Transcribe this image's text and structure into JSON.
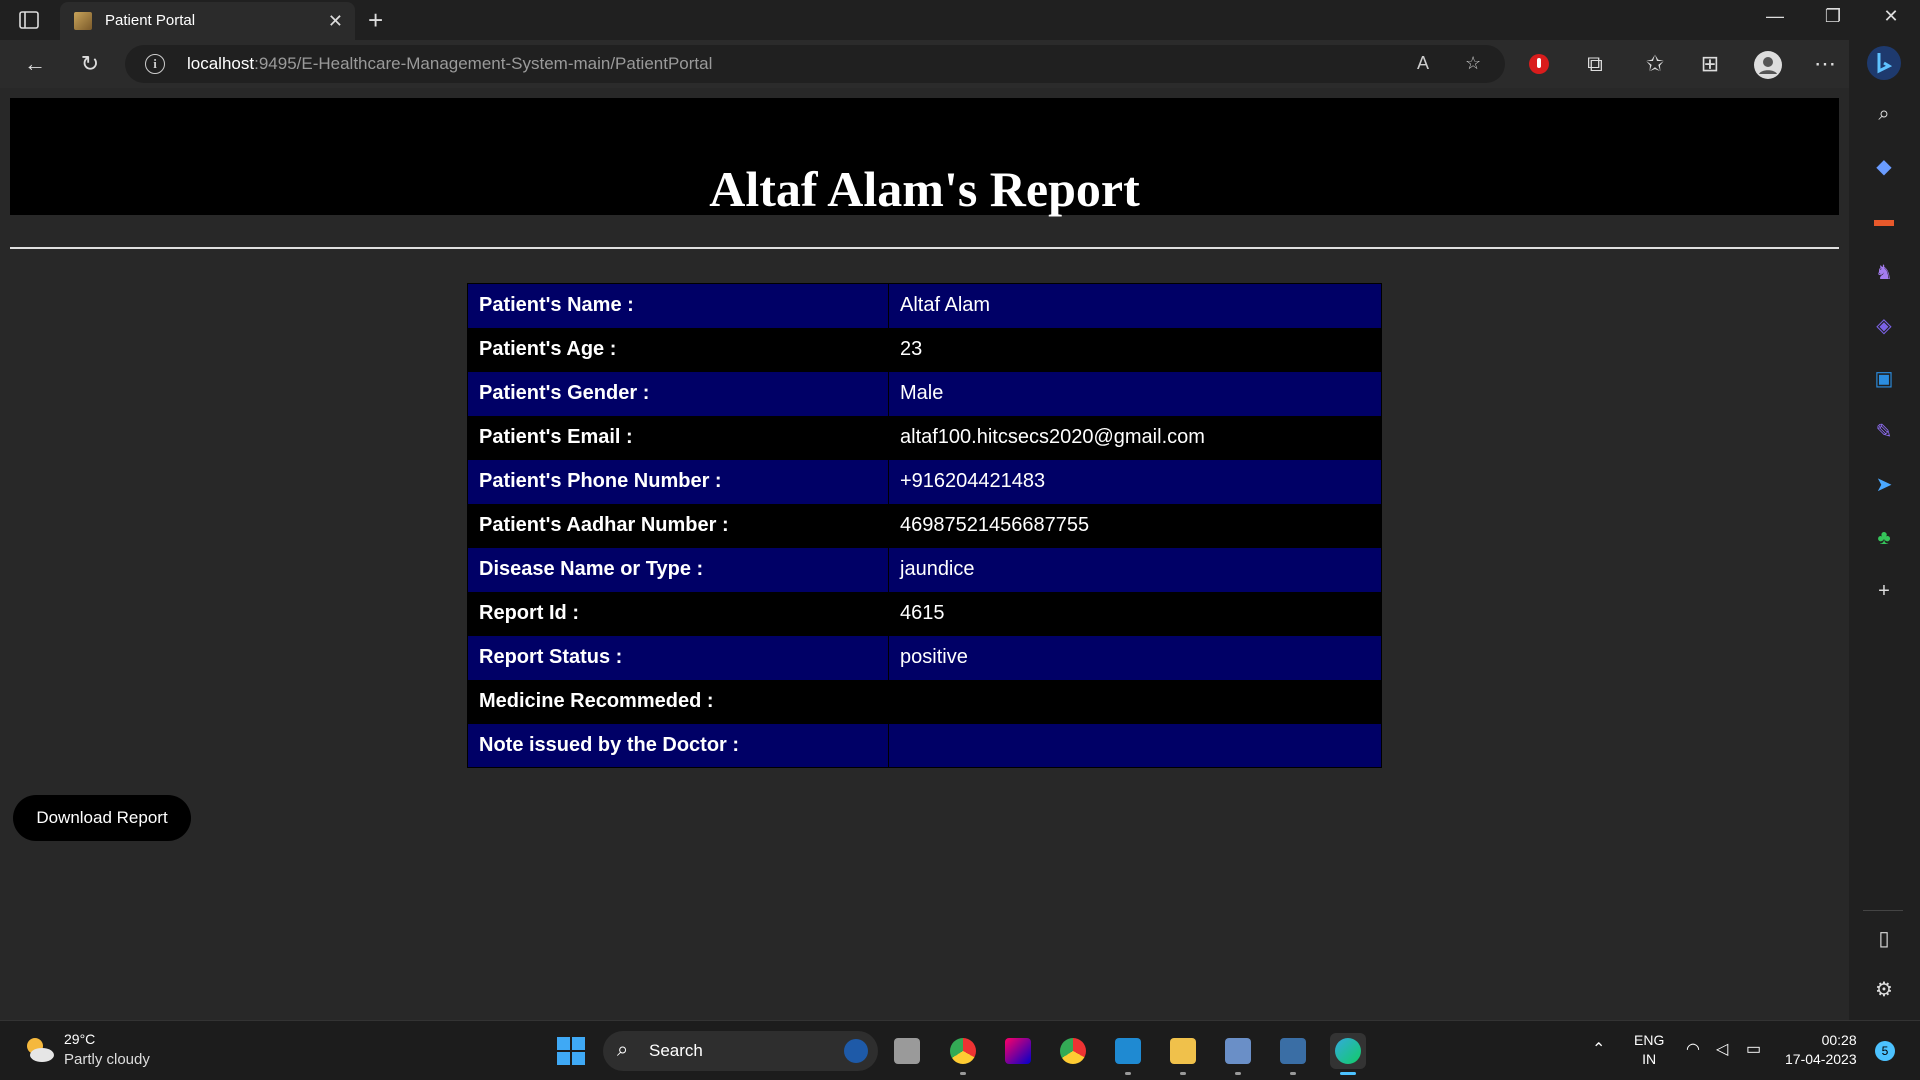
{
  "browser": {
    "tab_title": "Patient Portal",
    "url_host": "localhost",
    "url_path": ":9495/E-Healthcare-Management-System-main/PatientPortal"
  },
  "page": {
    "title": "Altaf Alam's Report",
    "rows": [
      {
        "label": "Patient's Name :",
        "value": "Altaf Alam"
      },
      {
        "label": "Patient's Age :",
        "value": "23"
      },
      {
        "label": "Patient's Gender :",
        "value": "Male"
      },
      {
        "label": "Patient's Email :",
        "value": "altaf100.hitcsecs2020@gmail.com"
      },
      {
        "label": "Patient's Phone Number :",
        "value": "+916204421483"
      },
      {
        "label": "Patient's Aadhar Number :",
        "value": "46987521456687755"
      },
      {
        "label": "Disease Name or Type :",
        "value": "jaundice"
      },
      {
        "label": "Report Id :",
        "value": "4615"
      },
      {
        "label": "Report Status :",
        "value": "positive"
      },
      {
        "label": "Medicine Recommeded :",
        "value": ""
      },
      {
        "label": "Note issued by the Doctor :",
        "value": ""
      }
    ],
    "download_label": "Download Report"
  },
  "colors": {
    "row_odd": "#000066",
    "row_even": "#000000",
    "page_bg": "#282828"
  },
  "taskbar": {
    "weather_temp": "29°C",
    "weather_desc": "Partly cloudy",
    "search_label": "Search",
    "lang_1": "ENG",
    "lang_2": "IN",
    "time": "00:28",
    "date": "17-04-2023",
    "notifications": "5"
  }
}
